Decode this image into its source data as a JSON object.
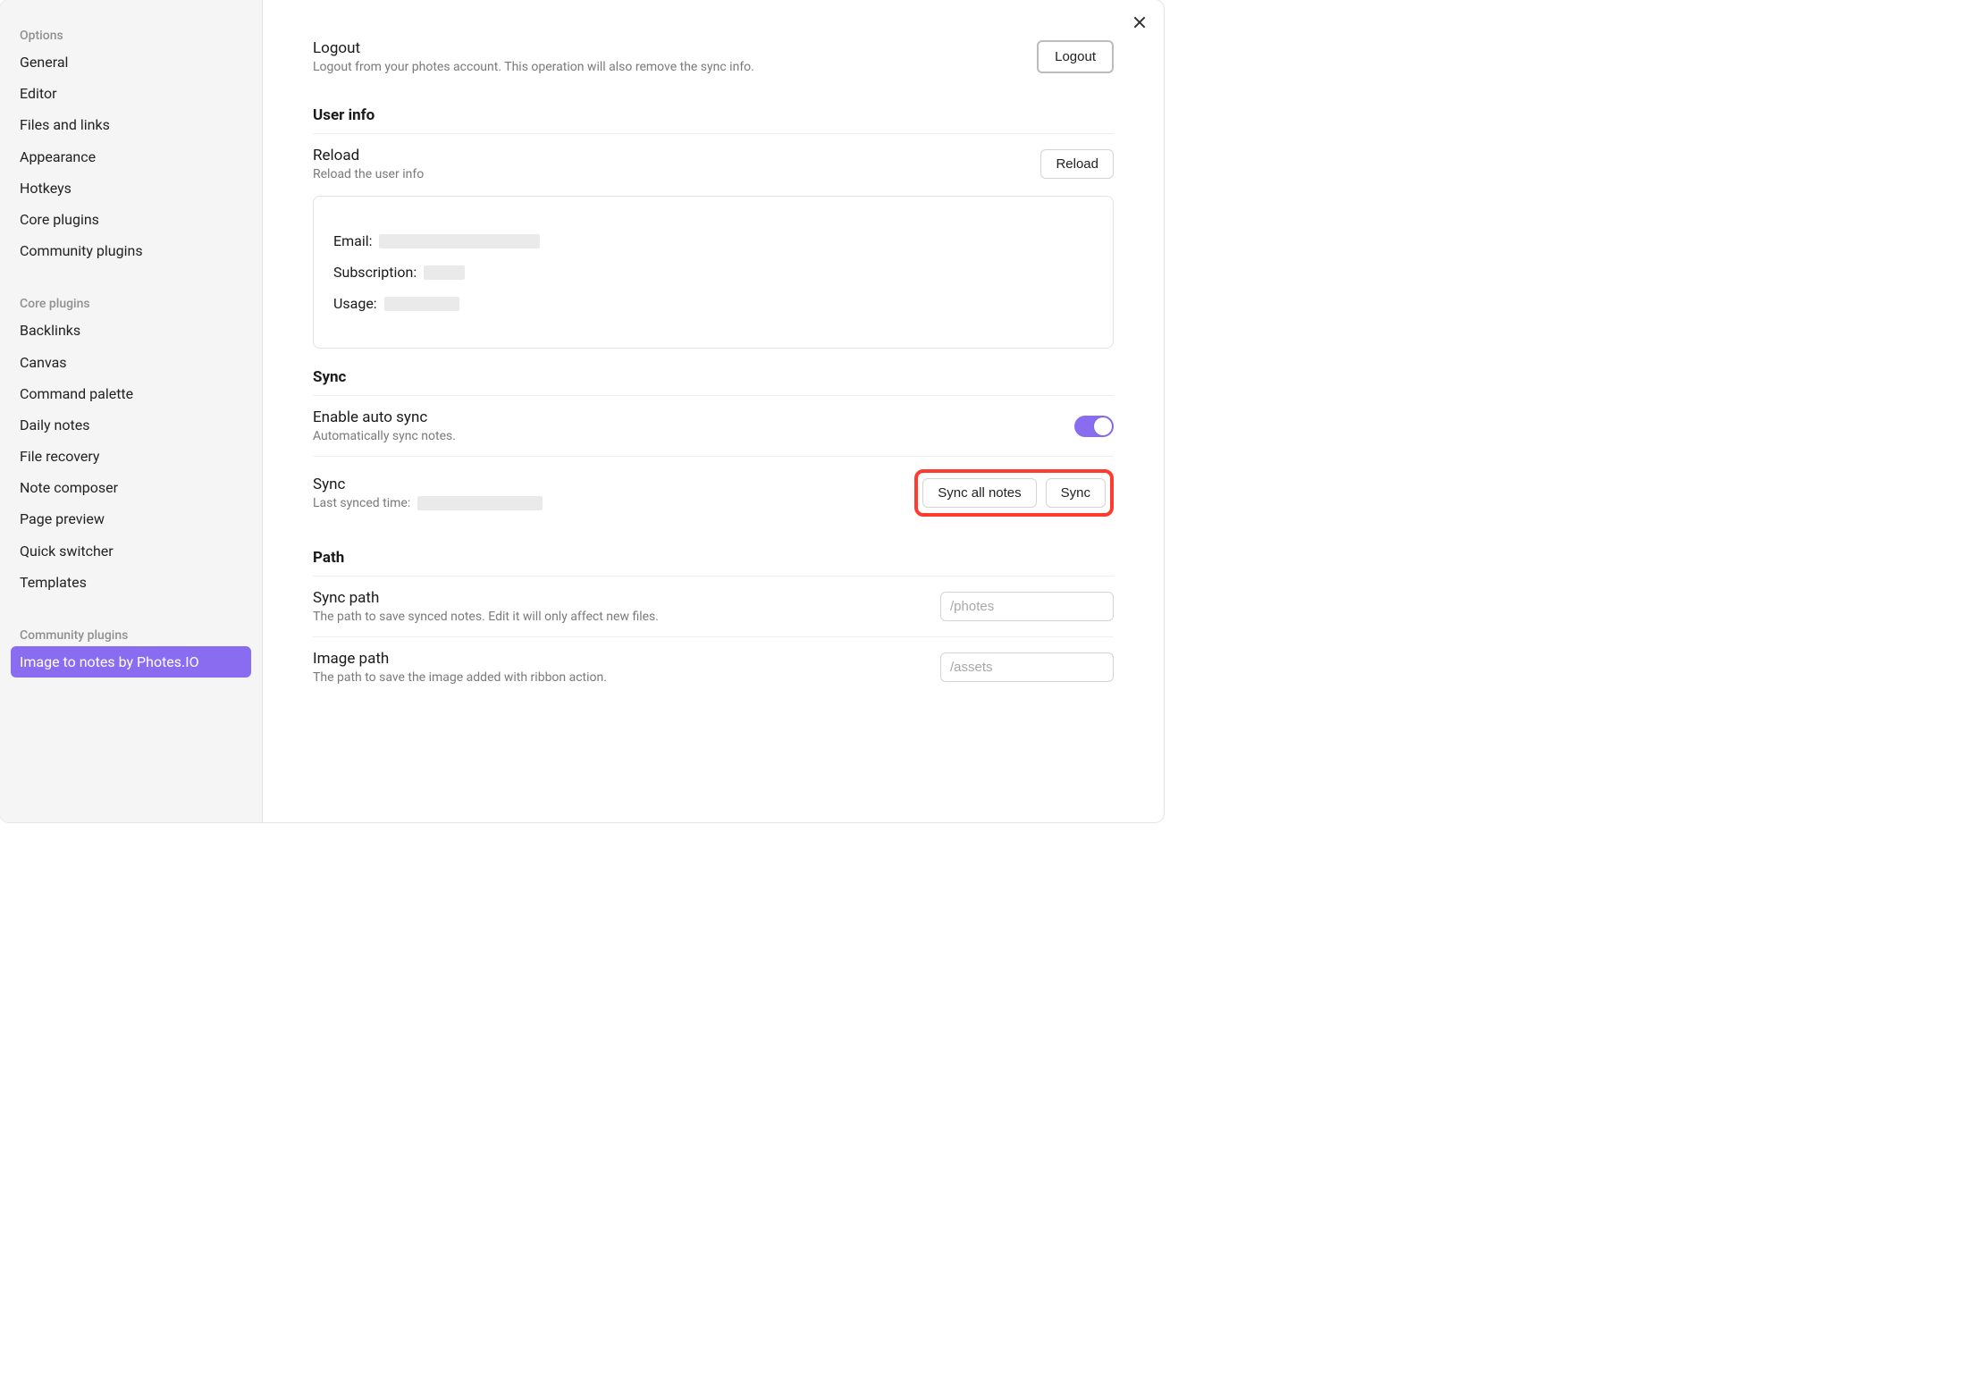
{
  "sidebar": {
    "options_label": "Options",
    "options_items": [
      {
        "label": "General"
      },
      {
        "label": "Editor"
      },
      {
        "label": "Files and links"
      },
      {
        "label": "Appearance"
      },
      {
        "label": "Hotkeys"
      },
      {
        "label": "Core plugins"
      },
      {
        "label": "Community plugins"
      }
    ],
    "coreplugins_label": "Core plugins",
    "coreplugins_items": [
      {
        "label": "Backlinks"
      },
      {
        "label": "Canvas"
      },
      {
        "label": "Command palette"
      },
      {
        "label": "Daily notes"
      },
      {
        "label": "File recovery"
      },
      {
        "label": "Note composer"
      },
      {
        "label": "Page preview"
      },
      {
        "label": "Quick switcher"
      },
      {
        "label": "Templates"
      }
    ],
    "community_label": "Community plugins",
    "community_items": [
      {
        "label": "Image to notes by Photes.IO",
        "active": true
      }
    ]
  },
  "content": {
    "logout": {
      "title": "Logout",
      "desc": "Logout from your photes account. This operation will also remove the sync info.",
      "button": "Logout"
    },
    "user_info_header": "User info",
    "reload": {
      "title": "Reload",
      "desc": "Reload the user info",
      "button": "Reload"
    },
    "user_card": {
      "email_label": "Email:",
      "subscription_label": "Subscription:",
      "usage_label": "Usage:"
    },
    "sync_header": "Sync",
    "auto_sync": {
      "title": "Enable auto sync",
      "desc": "Automatically sync notes."
    },
    "sync_row": {
      "title": "Sync",
      "desc_prefix": "Last synced time:",
      "sync_all_btn": "Sync all notes",
      "sync_btn": "Sync"
    },
    "path_header": "Path",
    "sync_path": {
      "title": "Sync path",
      "desc": "The path to save synced notes. Edit it will only affect new files.",
      "placeholder": "/photes"
    },
    "image_path": {
      "title": "Image path",
      "desc": "The path to save the image added with ribbon action.",
      "placeholder": "/assets"
    }
  }
}
